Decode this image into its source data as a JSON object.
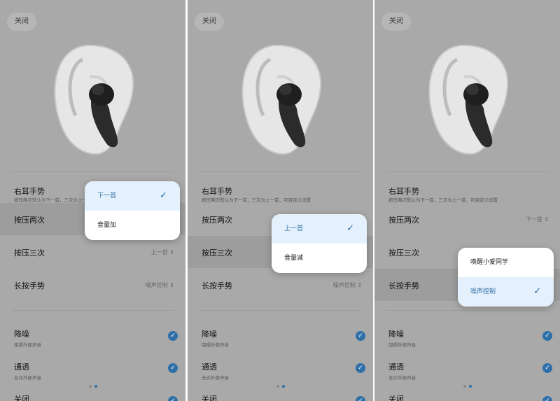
{
  "colors": {
    "panel_bg": "#a9a9a9",
    "accent": "#2f70a8",
    "selected_bg": "#e4f0fb"
  },
  "icons": {
    "check": "checkmark-icon",
    "updown": "chevron-updown-icon"
  },
  "panels": [
    {
      "close_label": "关闭",
      "gesture_title": "右耳手势",
      "gesture_subtitle": "按压两次默认为下一首，三次为上一首，可自定义设置",
      "rows": [
        {
          "label": "按压两次",
          "value": ""
        },
        {
          "label": "按压三次",
          "value": "上一首"
        },
        {
          "label": "长按手势",
          "value": "噪声控制"
        }
      ],
      "switches": [
        {
          "label": "降噪",
          "sub": "阻隔外部声音"
        },
        {
          "label": "通透",
          "sub": "允许外部声音"
        },
        {
          "label": "关闭",
          "sub": ""
        }
      ],
      "popup": {
        "options": [
          "下一首",
          "音量加"
        ]
      }
    },
    {
      "close_label": "关闭",
      "gesture_title": "右耳手势",
      "gesture_subtitle": "按压两次默认为下一首，三次为上一首，可自定义设置",
      "rows": [
        {
          "label": "按压两次",
          "value": ""
        },
        {
          "label": "按压三次",
          "value": ""
        },
        {
          "label": "长按手势",
          "value": "噪声控制"
        }
      ],
      "switches": [
        {
          "label": "降噪",
          "sub": "阻隔外部声音"
        },
        {
          "label": "通透",
          "sub": "允许外部声音"
        },
        {
          "label": "关闭",
          "sub": ""
        }
      ],
      "popup": {
        "options": [
          "上一首",
          "音量减"
        ]
      }
    },
    {
      "close_label": "关闭",
      "gesture_title": "右耳手势",
      "gesture_subtitle": "按压两次默认为下一首，三次为上一首，可自定义设置",
      "rows": [
        {
          "label": "按压两次",
          "value": "下一首"
        },
        {
          "label": "按压三次",
          "value": ""
        },
        {
          "label": "长按手势",
          "value": ""
        }
      ],
      "switches": [
        {
          "label": "降噪",
          "sub": "阻隔外部声音"
        },
        {
          "label": "通透",
          "sub": "允许外部声音"
        },
        {
          "label": "关闭",
          "sub": ""
        }
      ],
      "popup": {
        "options": [
          "唤醒小爱同学",
          "噪声控制"
        ]
      }
    }
  ]
}
